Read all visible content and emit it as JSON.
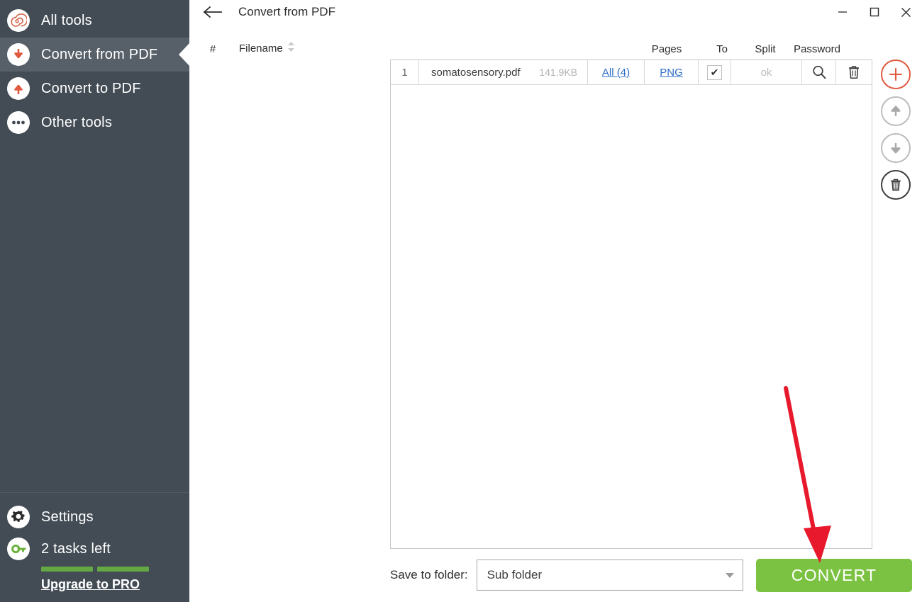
{
  "app": {
    "window_title": "Convert from PDF",
    "accent_red": "#e05a3f",
    "sidebar_bg": "#434c55",
    "sidebar_active_bg": "#575f69",
    "green": "#7cc242",
    "link_blue": "#2f6ec6",
    "annotation_color": "#e8192c"
  },
  "titlebar": {
    "back_icon": "back-arrow-icon",
    "title": "Convert from PDF",
    "minimize": "—",
    "maximize": "□",
    "close": "✕"
  },
  "sidebar": {
    "items": [
      {
        "label": "All tools",
        "icon": "spiral-icon",
        "active": false
      },
      {
        "label": "Convert from PDF",
        "icon": "arrow-down-icon",
        "active": true
      },
      {
        "label": "Convert to PDF",
        "icon": "arrow-up-icon",
        "active": false
      },
      {
        "label": "Other tools",
        "icon": "ellipsis-icon",
        "active": false
      }
    ],
    "footer": {
      "settings_label": "Settings",
      "settings_icon": "gear-icon",
      "tasks_label": "2 tasks left",
      "tasks_icon": "key-icon",
      "tasks_remaining": 2,
      "upgrade_label": "Upgrade to PRO"
    }
  },
  "table": {
    "headers": {
      "number": "#",
      "filename": "Filename",
      "pages": "Pages",
      "to": "To",
      "split": "Split",
      "password": "Password"
    },
    "sort_icon": "sort-updown-icon",
    "rows": [
      {
        "number": "1",
        "filename": "somatosensory.pdf",
        "size": "141.9KB",
        "pages": "All (4)",
        "to": "PNG",
        "split_checked": true,
        "split_mark": "✔",
        "password": "ok",
        "search_icon": "magnifier-icon",
        "delete_icon": "trash-icon"
      }
    ]
  },
  "right_toolbar": [
    {
      "name": "add-file-button",
      "icon": "plus-icon"
    },
    {
      "name": "move-up-button",
      "icon": "arrow-up-icon"
    },
    {
      "name": "move-down-button",
      "icon": "arrow-down-icon"
    },
    {
      "name": "clear-list-button",
      "icon": "trash-icon"
    }
  ],
  "bottom": {
    "save_label": "Save to folder:",
    "folder_value": "Sub folder",
    "folder_placeholder": "Sub folder",
    "convert_label": "CONVERT"
  }
}
